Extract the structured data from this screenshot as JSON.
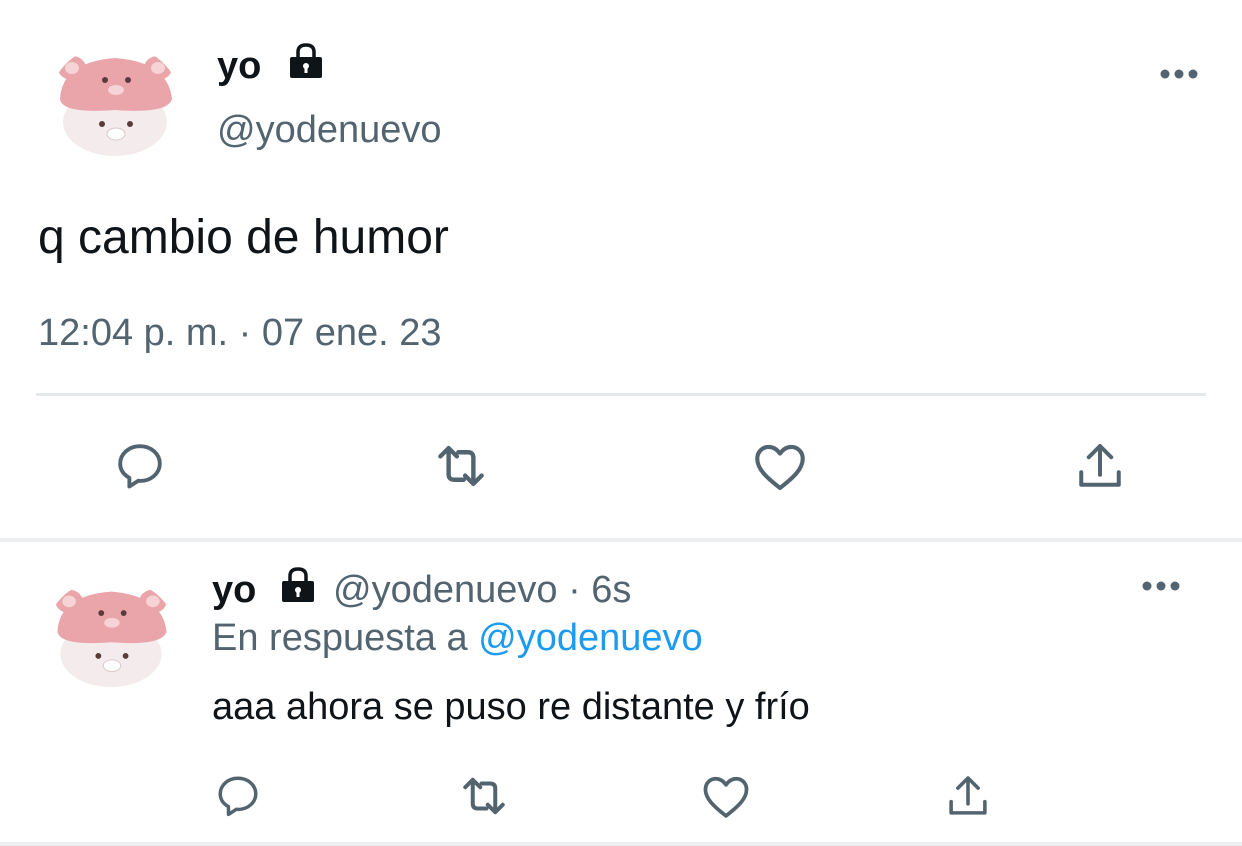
{
  "main_tweet": {
    "author": {
      "display_name": "yo",
      "handle": "@yodenuevo",
      "locked": true
    },
    "text": "q cambio de humor",
    "timestamp": "12:04 p. m. · 07 ene. 23",
    "more_icon": "more-icon",
    "actions": [
      "reply-icon",
      "retweet-icon",
      "like-icon",
      "share-icon"
    ]
  },
  "reply_tweet": {
    "author": {
      "display_name": "yo",
      "handle": "@yodenuevo",
      "locked": true
    },
    "time_ago": "· 6s",
    "reply_prefix": "En respuesta a",
    "reply_to": "@yodenuevo",
    "text": "aaa ahora se puso re distante y frío",
    "more_icon": "more-icon",
    "actions": [
      "reply-icon",
      "retweet-icon",
      "like-icon",
      "share-icon"
    ]
  },
  "colors": {
    "text": "#0f1419",
    "muted": "#536471",
    "link": "#1d9bf0",
    "divider": "#e6e9ec",
    "icon": "#536471"
  }
}
